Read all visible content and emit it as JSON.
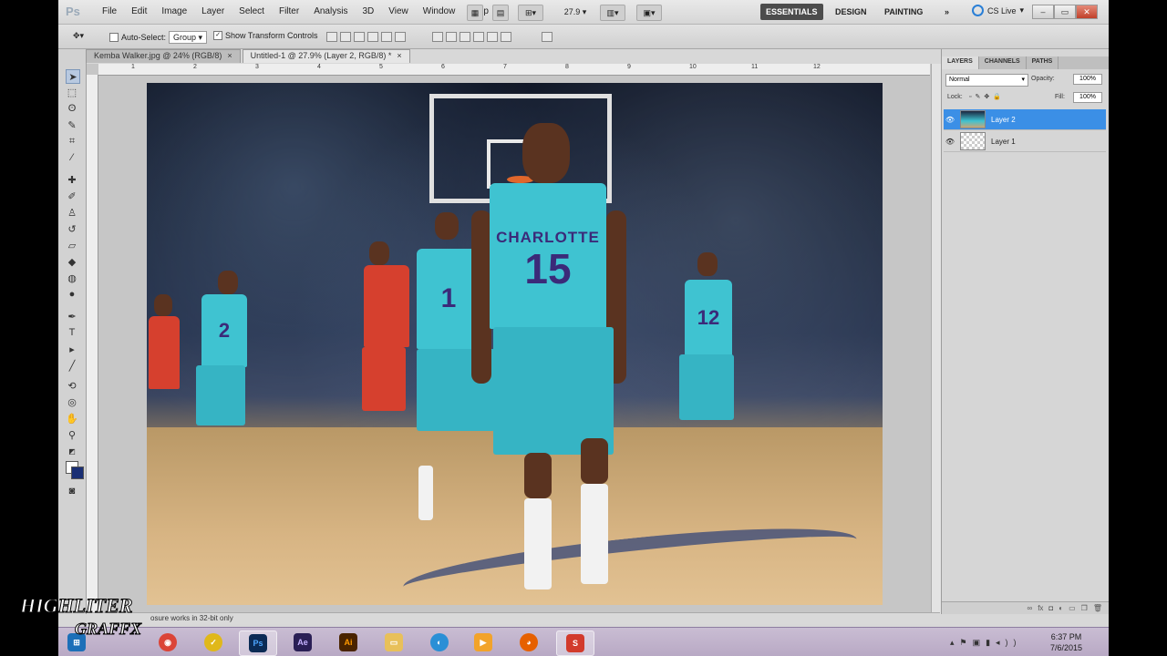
{
  "app": {
    "logo": "Ps"
  },
  "menu": [
    "File",
    "Edit",
    "Image",
    "Layer",
    "Select",
    "Filter",
    "Analysis",
    "3D",
    "View",
    "Window",
    "Help"
  ],
  "menubar_controls": {
    "zoom": "27.9"
  },
  "workspaces": {
    "essentials": "ESSENTIALS",
    "design": "DESIGN",
    "painting": "PAINTING",
    "more": "»"
  },
  "cs_live": "CS Live",
  "options_bar": {
    "auto_select_label": "Auto-Select:",
    "auto_select_value": "Group",
    "show_transform_label": "Show Transform Controls"
  },
  "document_tabs": [
    {
      "label": "Kemba Walker.jpg @ 24% (RGB/8)",
      "close": "×"
    },
    {
      "label": "Untitled-1 @ 27.9% (Layer 2, RGB/8) *",
      "close": "×"
    }
  ],
  "ruler_top": [
    "1",
    "2",
    "3",
    "4",
    "5",
    "6",
    "7",
    "8",
    "9",
    "10",
    "11",
    "12"
  ],
  "photo": {
    "player_main_text": "CHARLOTTE",
    "player_main_number": "15",
    "player_left_number": "1",
    "player_far_left_number": "2",
    "player_right_number": "12"
  },
  "status_text": "osure works in 32-bit only",
  "panel": {
    "tabs": [
      "LAYERS",
      "CHANNELS",
      "PATHS"
    ],
    "blend_mode": "Normal",
    "opacity_label": "Opacity:",
    "opacity_value": "100%",
    "lock_label": "Lock:",
    "fill_label": "Fill:",
    "fill_value": "100%",
    "layers": [
      {
        "name": "Layer 2",
        "selected": true
      },
      {
        "name": "Layer 1",
        "selected": false
      }
    ]
  },
  "taskbar": {
    "apps": [
      "ie",
      "chrome",
      "norton",
      "Ps",
      "Ae",
      "Ai",
      "folder",
      "media",
      "player",
      "firefox",
      "snagit"
    ],
    "time": "6:37 PM",
    "date": "7/6/2015"
  },
  "watermark": "HIGHLITER GRAFFX",
  "colors": {
    "accent_selection": "#3b8fe6",
    "jersey": "#3fc3d1",
    "jersey_text": "#3b2a79",
    "close": "#c0402a"
  }
}
